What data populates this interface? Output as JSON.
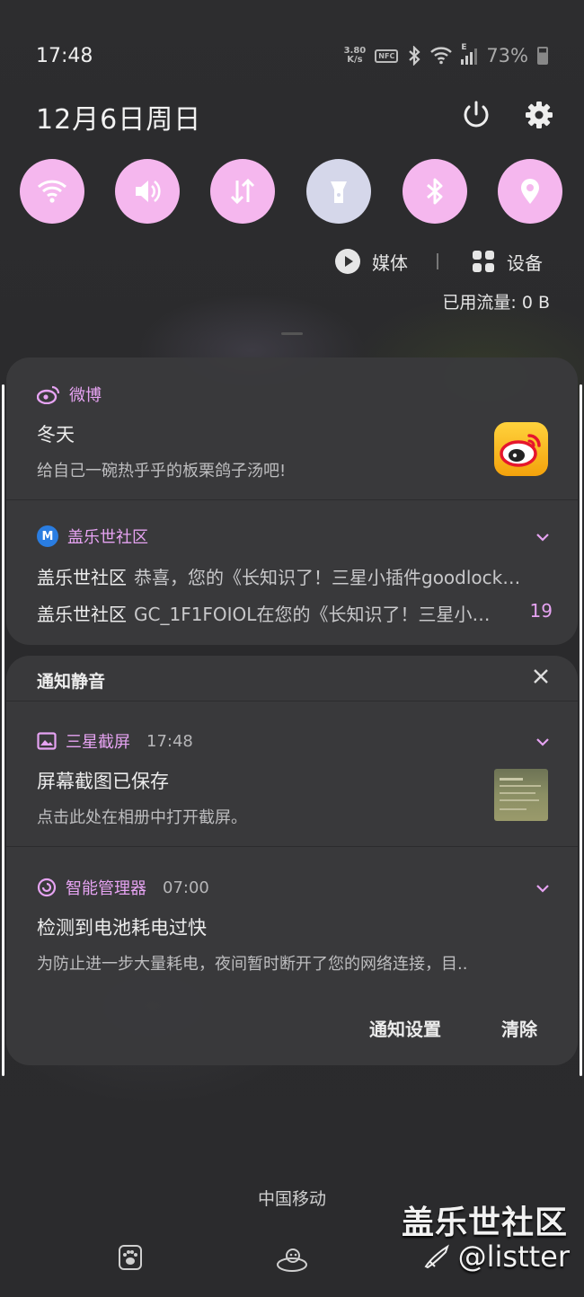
{
  "status_bar": {
    "time": "17:48",
    "net_speed_value": "3.80",
    "net_speed_unit": "K/s",
    "nfc_label": "NFC",
    "signal_type": "E",
    "battery": "73%"
  },
  "header": {
    "date": "12月6日周日",
    "power_icon": "power-icon",
    "settings_icon": "gear-icon"
  },
  "quick_settings": [
    {
      "name": "wifi",
      "icon": "wifi-icon",
      "active": true
    },
    {
      "name": "sound",
      "icon": "volume-icon",
      "active": true
    },
    {
      "name": "mobile-data",
      "icon": "data-arrows-icon",
      "active": true
    },
    {
      "name": "flashlight",
      "icon": "flashlight-icon",
      "active": false
    },
    {
      "name": "bluetooth",
      "icon": "bluetooth-icon",
      "active": true
    },
    {
      "name": "location",
      "icon": "location-icon",
      "active": true
    }
  ],
  "accent_color": "#f5b7ee",
  "media_row": {
    "media_label": "媒体",
    "devices_label": "设备"
  },
  "data_usage": "已用流量: 0 B",
  "notifications": {
    "weibo": {
      "app": "微博",
      "title": "冬天",
      "body": "给自己一碗热乎乎的板栗鸽子汤吧!"
    },
    "community": {
      "app": "盖乐世社区",
      "lines": [
        {
          "sender": "盖乐世社区",
          "text": "恭喜，您的《长知识了！三星小插件goodlock…"
        },
        {
          "sender": "盖乐世社区",
          "text": "GC_1F1FOIOL在您的《长知识了！三星小…",
          "count": "19"
        }
      ]
    },
    "silent_header": "通知静音",
    "screenshot": {
      "app": "三星截屏",
      "time": "17:48",
      "title": "屏幕截图已保存",
      "body": "点击此处在相册中打开截屏。"
    },
    "manager": {
      "app": "智能管理器",
      "time": "07:00",
      "title": "检测到电池耗电过快",
      "body": "为防止进一步大量耗电，夜间暂时断开了您的网络连接，目.."
    },
    "footer": {
      "settings": "通知设置",
      "clear": "清除"
    }
  },
  "carrier": "中国移动",
  "watermark": {
    "line1": "盖乐世社区",
    "line2": "@listter"
  }
}
